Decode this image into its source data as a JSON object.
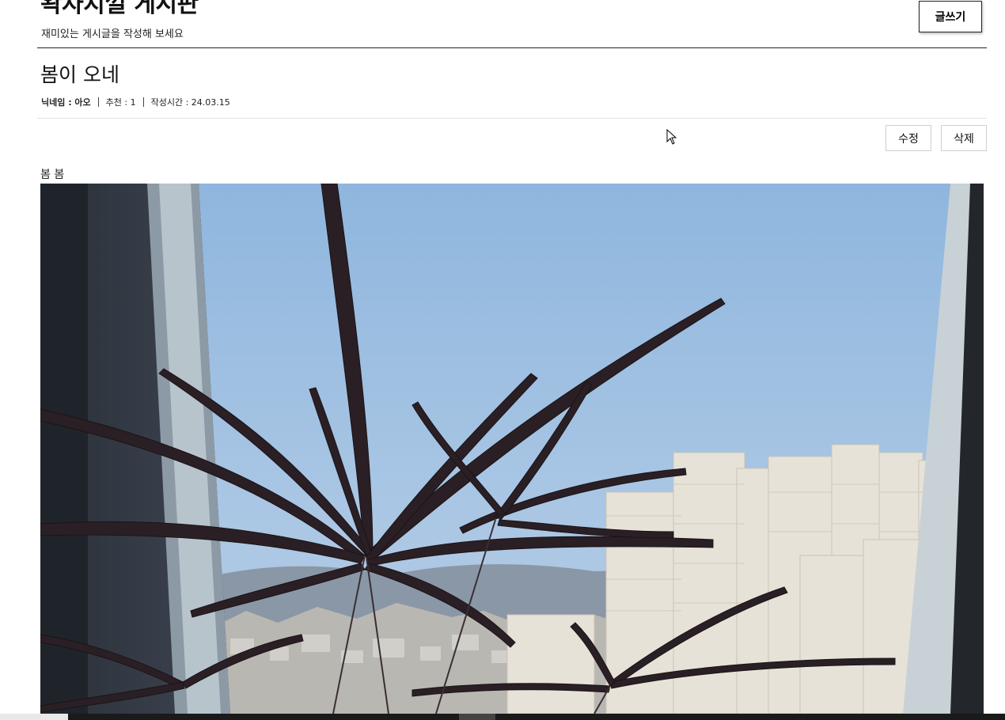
{
  "header": {
    "board_title": "왁자지껄 게시판",
    "board_subtitle": "재미있는 게시글을 작성해 보세요",
    "write_button": "글쓰기"
  },
  "post": {
    "title": "봄이 오네",
    "meta": {
      "nickname_label": "닉네임 : 아오",
      "recommend_label": "추천 : 1",
      "time_label": "작성시간 : 24.03.15"
    },
    "actions": {
      "edit_label": "수정",
      "delete_label": "삭제"
    },
    "body_text": "봄 봄",
    "image": {
      "icon": "post-photo-plant-window"
    }
  },
  "colors": {
    "text": "#111111",
    "divider": "#222222",
    "light_divider": "#e4e4e4",
    "sky": "#9ec0e2",
    "leaf": "#2a1f24"
  }
}
